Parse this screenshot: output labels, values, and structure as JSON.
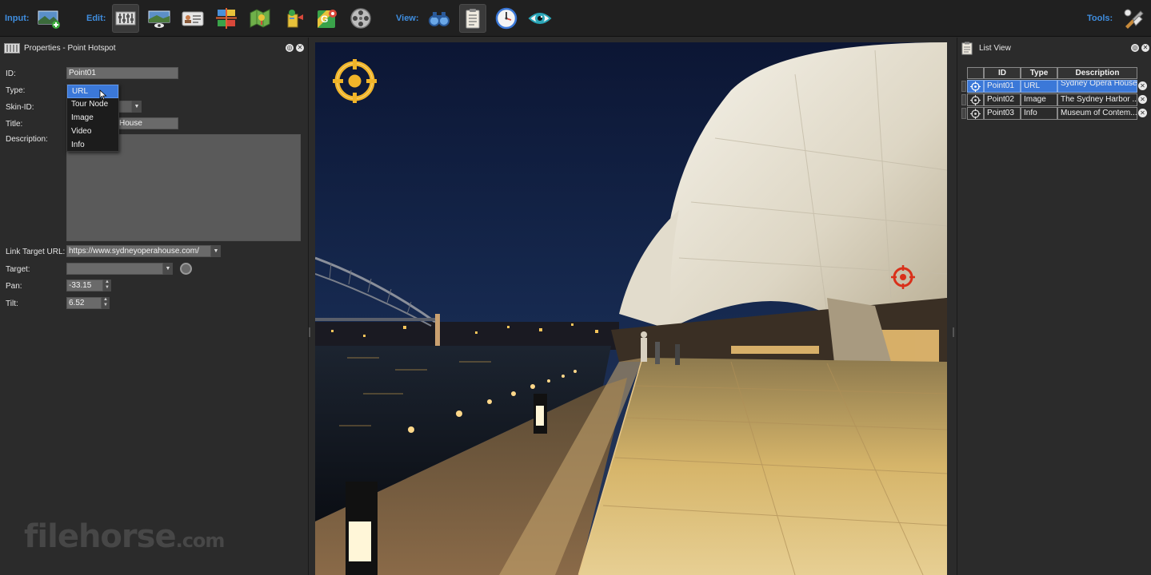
{
  "toolbar": {
    "input_label": "Input:",
    "edit_label": "Edit:",
    "view_label": "View:",
    "tools_label": "Tools:",
    "accent_color": "#3f8ee0",
    "input_icons": [
      "add-panorama-icon"
    ],
    "edit_icons": [
      "sliders-icon",
      "viewing-parameters-icon",
      "user-data-icon",
      "tour-browser-icon",
      "tour-map-icon",
      "tour-map-point-icon",
      "google-maps-icon",
      "media-reel-icon"
    ],
    "view_icons": [
      "binoculars-icon",
      "clipboard-icon",
      "clock-icon",
      "eye-icon"
    ],
    "tools_icons": [
      "tools-icon"
    ]
  },
  "properties_panel": {
    "title": "Properties - Point Hotspot",
    "labels": {
      "id": "ID:",
      "type": "Type:",
      "skin_id": "Skin-ID:",
      "title": "Title:",
      "description": "Description:",
      "link_target_url": "Link Target URL:",
      "target": "Target:",
      "pan": "Pan:",
      "tilt": "Tilt:"
    },
    "values": {
      "id": "Point01",
      "type": "URL",
      "skin_id": "",
      "title_partial": "House",
      "description": "",
      "link_target_url": "https://www.sydneyoperahouse.com/",
      "target": "",
      "pan": "-33.15",
      "tilt": "6.52"
    },
    "type_dropdown_options": [
      "URL",
      "Tour Node",
      "Image",
      "Video",
      "Info"
    ],
    "type_dropdown_selected_index": 0
  },
  "watermark": {
    "text": "filehorse",
    "suffix": ".com"
  },
  "list_view": {
    "title": "List View",
    "columns": [
      "ID",
      "Type",
      "Description"
    ],
    "rows": [
      {
        "id": "Point01",
        "type": "URL",
        "description": "Sydney Opera House"
      },
      {
        "id": "Point02",
        "type": "Image",
        "description": "The Sydney Harbor ..."
      },
      {
        "id": "Point03",
        "type": "Info",
        "description": "Museum of Contem..."
      }
    ],
    "selected_row_index": 0,
    "selection_color": "#3b78d8"
  },
  "viewport": {
    "hotspot_selected_color": "#f0b429",
    "hotspot_color": "#d9301a"
  }
}
